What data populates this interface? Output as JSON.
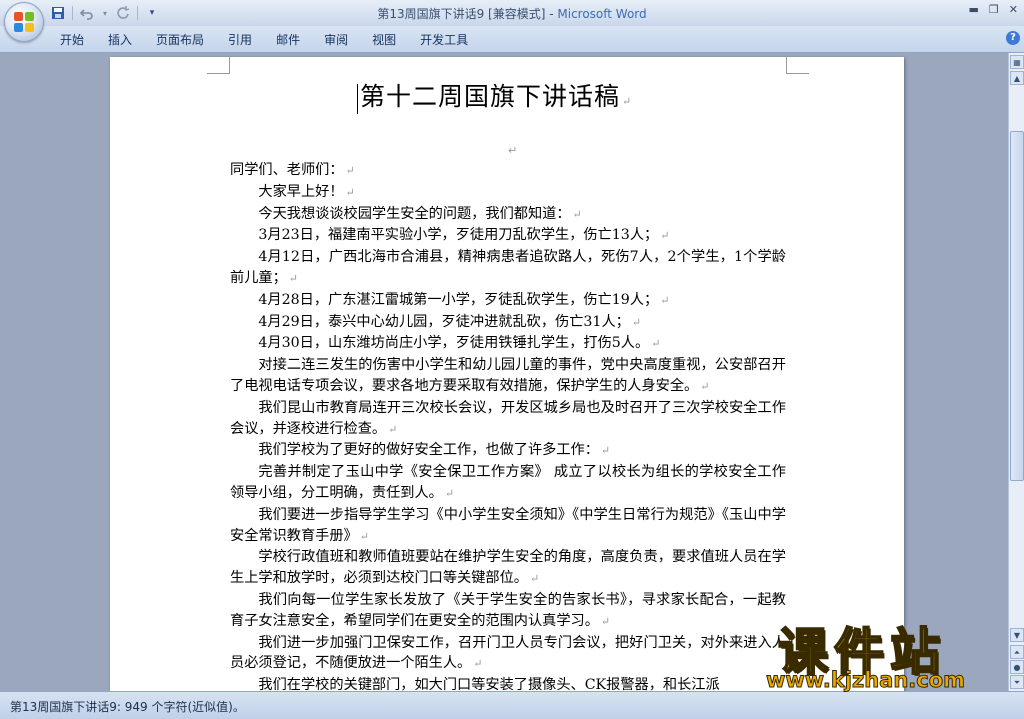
{
  "window": {
    "title_doc": "第13周国旗下讲话9 [兼容模式] - ",
    "title_app": "Microsoft Word"
  },
  "quick_access": {
    "icons": [
      "save-icon",
      "undo-icon",
      "redo-icon",
      "customize-icon"
    ]
  },
  "ribbon": {
    "tabs": [
      "开始",
      "插入",
      "页面布局",
      "引用",
      "邮件",
      "审阅",
      "视图",
      "开发工具"
    ]
  },
  "document": {
    "title": "第十二周国旗下讲话稿",
    "paragraphs": [
      {
        "text": "同学们、老师们：",
        "indent": false
      },
      {
        "text": "大家早上好！",
        "indent": true
      },
      {
        "text": "今天我想谈谈校园学生安全的问题，我们都知道：",
        "indent": true
      },
      {
        "text": "3月23日，福建南平实验小学，歹徒用刀乱砍学生，伤亡13人；",
        "indent": true
      },
      {
        "text": "4月12日，广西北海市合浦县，精神病患者追砍路人，死伤7人，2个学生，1个学龄前儿童；",
        "indent": true
      },
      {
        "text": "4月28日，广东湛江雷城第一小学，歹徒乱砍学生，伤亡19人；",
        "indent": true
      },
      {
        "text": "4月29日，泰兴中心幼儿园，歹徒冲进就乱砍，伤亡31人；",
        "indent": true
      },
      {
        "text": "4月30日，山东潍坊尚庄小学，歹徒用铁锤扎学生，打伤5人。",
        "indent": true
      },
      {
        "text": "对接二连三发生的伤害中小学生和幼儿园儿童的事件，党中央高度重视，公安部召开了电视电话专项会议，要求各地方要采取有效措施，保护学生的人身安全。",
        "indent": true
      },
      {
        "text": "我们昆山市教育局连开三次校长会议，开发区城乡局也及时召开了三次学校安全工作会议，并逐校进行检查。",
        "indent": true
      },
      {
        "text": "我们学校为了更好的做好安全工作，也做了许多工作：",
        "indent": true
      },
      {
        "text": "完善并制定了玉山中学《安全保卫工作方案》 成立了以校长为组长的学校安全工作领导小组，分工明确，责任到人。",
        "indent": true
      },
      {
        "text": "我们要进一步指导学生学习《中小学生安全须知》《中学生日常行为规范》《玉山中学安全常识教育手册》",
        "indent": true
      },
      {
        "text": "学校行政值班和教师值班要站在维护学生安全的角度，高度负责，要求值班人员在学生上学和放学时，必须到达校门口等关键部位。",
        "indent": true
      },
      {
        "text": "我们向每一位学生家长发放了《关于学生安全的告家长书》，寻求家长配合，一起教育子女注意安全，希望同学们在更安全的范围内认真学习。",
        "indent": true
      },
      {
        "text": "我们进一步加强门卫保安工作，召开门卫人员专门会议，把好门卫关，对外来进入人员必须登记，不随便放进一个陌生人。",
        "indent": true
      },
      {
        "text": "我们在学校的关键部门，如大门口等安装了摄像头、CK报警器，和长江派",
        "indent": true
      }
    ]
  },
  "statusbar": {
    "text": "第13周国旗下讲话9: 949 个字符(近似值)。"
  },
  "watermark": {
    "brand": "课件站",
    "url": "www.kjzhan.com"
  }
}
